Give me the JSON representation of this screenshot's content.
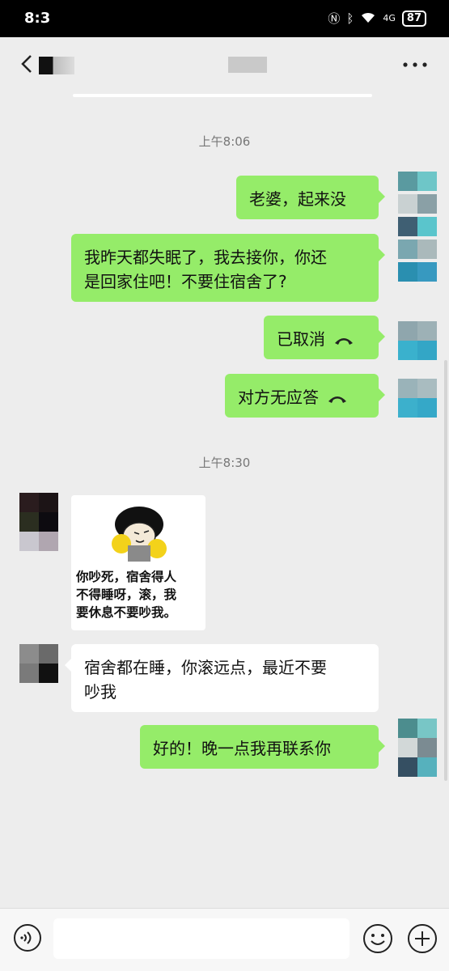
{
  "status_bar": {
    "time": "8:3",
    "network": "4G",
    "battery": "87"
  },
  "header": {
    "back_label": "<",
    "more_label": "..."
  },
  "chat": {
    "time1": "上午8:06",
    "msg1": "老婆，起来没",
    "msg2_line1": "我昨天都失眠了，我去接你，你还",
    "msg2_line2": "是回家住吧！不要住宿舍了?",
    "call1": "已取消",
    "call2": "对方无应答",
    "time2": "上午8:30",
    "sticker_line1": "你吵死，宿舍得人",
    "sticker_line2": "不得睡呀，滚，我",
    "sticker_line3": "要休息不要吵我。",
    "reply_line1": "宿舍都在睡，你滚远点，最近不要",
    "reply_line2": "吵我",
    "msg_last": "好的！晚一点我再联系你"
  },
  "input_bar": {
    "placeholder": ""
  },
  "colors": {
    "me_bubble": "#95ec69",
    "them_bubble": "#ffffff",
    "background": "#ededed"
  },
  "icons": [
    "back-arrow-icon",
    "more-dots-icon",
    "phone-hangup-icon",
    "voice-icon",
    "emoji-icon",
    "plus-icon",
    "wifi-icon",
    "bluetooth-icon",
    "nfc-icon",
    "battery-icon"
  ]
}
